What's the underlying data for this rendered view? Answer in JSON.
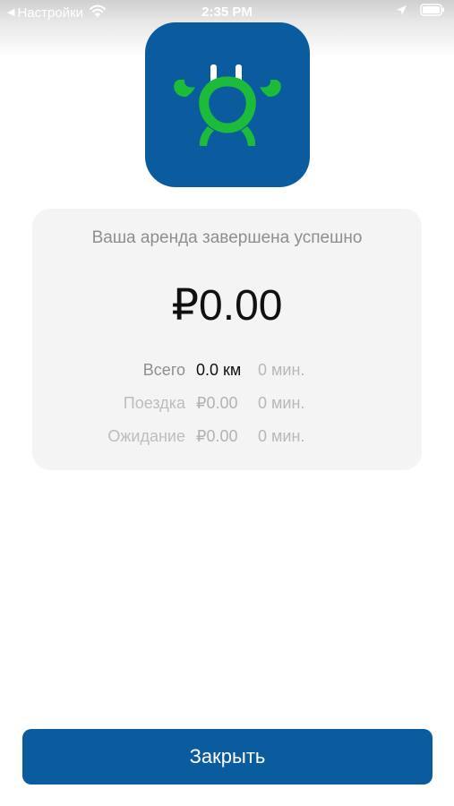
{
  "status_bar": {
    "back_app": "Настройки",
    "time": "2:35 PM"
  },
  "icons": {
    "back": "back-triangle-icon",
    "wifi": "wifi-icon",
    "location": "location-arrow-icon",
    "battery": "battery-icon",
    "app": "crab-plug-logo"
  },
  "colors": {
    "brand_blue": "#0b5c9e",
    "logo_green": "#1dbb3a",
    "card_bg": "#f4f4f4"
  },
  "summary": {
    "title": "Ваша аренда завершена успешно",
    "amount": "₽0.00",
    "rows": [
      {
        "label": "Всего",
        "value": "0.0 км",
        "time": "0 мин."
      },
      {
        "label": "Поездка",
        "value": "₽0.00",
        "time": "0 мин."
      },
      {
        "label": "Ожидание",
        "value": "₽0.00",
        "time": "0 мин."
      }
    ]
  },
  "actions": {
    "close_label": "Закрыть"
  }
}
